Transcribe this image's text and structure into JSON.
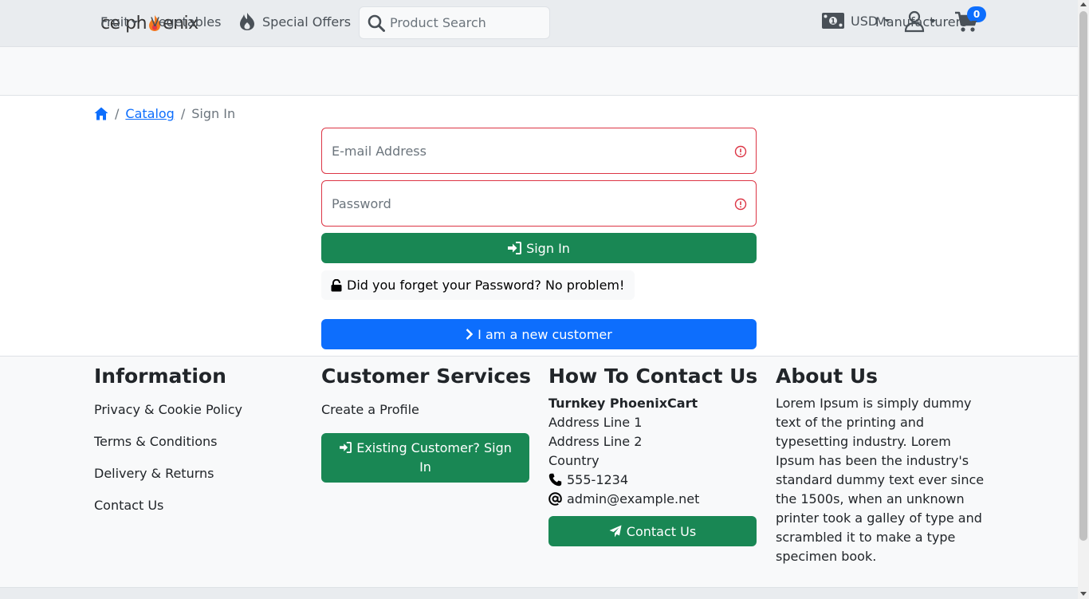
{
  "header": {
    "logo_text_left": "ce ph",
    "logo_text_right": "enix",
    "special_offers": "Special Offers",
    "search_placeholder": "Product Search",
    "currency": "USD",
    "cart_count": "0"
  },
  "nav": {
    "fruit": "Fruit",
    "vegetables": "Vegetables",
    "manufacturers": "Manufacturers"
  },
  "breadcrumb": {
    "catalog": "Catalog",
    "current": "Sign In",
    "separator": "/"
  },
  "form": {
    "email_placeholder": "E-mail Address",
    "password_placeholder": "Password",
    "sign_in": "Sign In",
    "forgot": "Did you forget your Password? No problem!",
    "new_customer": "I am a new customer"
  },
  "footer": {
    "information": {
      "title": "Information",
      "links": [
        "Privacy & Cookie Policy",
        "Terms & Conditions",
        "Delivery & Returns",
        "Contact Us"
      ]
    },
    "customer_services": {
      "title": "Customer Services",
      "create_profile": "Create a Profile",
      "existing_customer": "Existing Customer? Sign In"
    },
    "contact": {
      "title": "How To Contact Us",
      "company": "Turnkey PhoenixCart",
      "address1": "Address Line 1",
      "address2": "Address Line 2",
      "country": "Country",
      "phone": "555-1234",
      "email": "admin@example.net",
      "contact_button": "Contact Us"
    },
    "about": {
      "title": "About Us",
      "text": "Lorem Ipsum is simply dummy text of the printing and typesetting industry. Lorem Ipsum has been the industry's standard dummy text ever since the 1500s, when an unknown printer took a galley of type and scrambled it to make a type specimen book."
    }
  },
  "colors": {
    "success": "#198754",
    "primary": "#0d6efd",
    "danger": "#dc3545"
  }
}
